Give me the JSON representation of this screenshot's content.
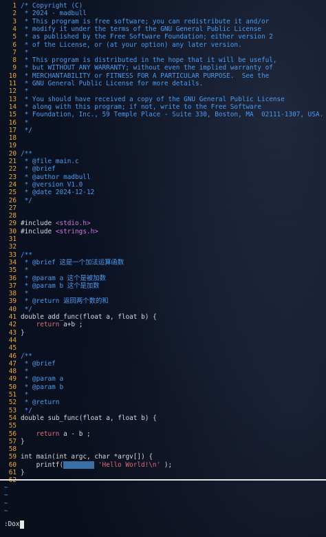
{
  "editor": {
    "lines": [
      {
        "n": "1",
        "t": "/* Copyright (C)",
        "k": "cmt"
      },
      {
        "n": "2",
        "t": " * 2024 - madbull",
        "k": "cmt"
      },
      {
        "n": "3",
        "t": " * This program is free software; you can redistribute it and/or",
        "k": "cmt"
      },
      {
        "n": "4",
        "t": " * modify it under the terms of the GNU General Public License",
        "k": "cmt"
      },
      {
        "n": "5",
        "t": " * as published by the Free Software Foundation; either version 2",
        "k": "cmt"
      },
      {
        "n": "6",
        "t": " * of the License, or (at your option) any later version.",
        "k": "cmt"
      },
      {
        "n": "7",
        "t": " *",
        "k": "cmt"
      },
      {
        "n": "8",
        "t": " * This program is distributed in the hope that it will be useful,",
        "k": "cmt"
      },
      {
        "n": "9",
        "t": " * but WITHOUT ANY WARRANTY; without even the implied warranty of",
        "k": "cmt"
      },
      {
        "n": "10",
        "t": " * MERCHANTABILITY or FITNESS FOR A PARTICULAR PURPOSE.  See the",
        "k": "cmt"
      },
      {
        "n": "11",
        "t": " * GNU General Public License for more details.",
        "k": "cmt"
      },
      {
        "n": "12",
        "t": " *",
        "k": "cmt"
      },
      {
        "n": "13",
        "t": " * You should have received a copy of the GNU General Public License",
        "k": "cmt"
      },
      {
        "n": "14",
        "t": " * along with this program; if not, write to the Free Software",
        "k": "cmt"
      },
      {
        "n": "15",
        "t": " * Foundation, Inc., 59 Temple Place - Suite 330, Boston, MA  02111-1307, USA.",
        "k": "cmt"
      },
      {
        "n": "16",
        "t": " *",
        "k": "cmt"
      },
      {
        "n": "17",
        "t": " */",
        "k": "cmt"
      },
      {
        "n": "18",
        "t": "",
        "k": "plain"
      },
      {
        "n": "19",
        "t": "",
        "k": "plain"
      },
      {
        "n": "20",
        "t": "/**",
        "k": "cmt"
      },
      {
        "n": "21",
        "t": " * @file main.c",
        "k": "cmt"
      },
      {
        "n": "22",
        "t": " * @brief",
        "k": "cmt"
      },
      {
        "n": "23",
        "t": " * @author madbull",
        "k": "cmt"
      },
      {
        "n": "24",
        "t": " * @version V1.0",
        "k": "cmt"
      },
      {
        "n": "25",
        "t": " * @date 2024-12-12",
        "k": "cmt"
      },
      {
        "n": "26",
        "t": " */",
        "k": "cmt"
      },
      {
        "n": "27",
        "t": "",
        "k": "plain"
      },
      {
        "n": "28",
        "t": "",
        "k": "plain"
      },
      {
        "n": "29",
        "t": "#include ",
        "k": "pp",
        "extra": "<stdio.h>"
      },
      {
        "n": "30",
        "t": "#include ",
        "k": "pp",
        "extra": "<strings.h>"
      },
      {
        "n": "31",
        "t": "",
        "k": "plain"
      },
      {
        "n": "32",
        "t": "",
        "k": "plain"
      },
      {
        "n": "33",
        "t": "/**",
        "k": "cmt"
      },
      {
        "n": "34",
        "t": " * @brief 这是一个加法运算函数",
        "k": "cmt"
      },
      {
        "n": "35",
        "t": " *",
        "k": "cmt"
      },
      {
        "n": "36",
        "t": " * @param a 这个是被加数",
        "k": "cmt"
      },
      {
        "n": "37",
        "t": " * @param b 这个是加数",
        "k": "cmt"
      },
      {
        "n": "38",
        "t": " *",
        "k": "cmt"
      },
      {
        "n": "39",
        "t": " * @return 返回两个数的和",
        "k": "cmt"
      },
      {
        "n": "40",
        "t": " */",
        "k": "cmt"
      },
      {
        "n": "41",
        "t": "double add_func(float a, float b) {",
        "k": "plain"
      },
      {
        "n": "42",
        "t": "    return a+b ;",
        "k": "ret"
      },
      {
        "n": "43",
        "t": "}",
        "k": "plain"
      },
      {
        "n": "44",
        "t": "",
        "k": "plain"
      },
      {
        "n": "45",
        "t": "",
        "k": "plain"
      },
      {
        "n": "46",
        "t": "/**",
        "k": "cmt"
      },
      {
        "n": "47",
        "t": " * @brief",
        "k": "cmt"
      },
      {
        "n": "48",
        "t": " *",
        "k": "cmt"
      },
      {
        "n": "49",
        "t": " * @param a",
        "k": "cmt"
      },
      {
        "n": "50",
        "t": " * @param b",
        "k": "cmt"
      },
      {
        "n": "51",
        "t": " *",
        "k": "cmt"
      },
      {
        "n": "52",
        "t": " * @return",
        "k": "cmt"
      },
      {
        "n": "53",
        "t": " */",
        "k": "cmt"
      },
      {
        "n": "54",
        "t": "double sub_func(float a, float b) {",
        "k": "plain"
      },
      {
        "n": "55",
        "t": "",
        "k": "plain"
      },
      {
        "n": "56",
        "t": "    return a - b ;",
        "k": "ret"
      },
      {
        "n": "57",
        "t": "}",
        "k": "plain"
      },
      {
        "n": "58",
        "t": "",
        "k": "plain"
      },
      {
        "n": "59",
        "t": "int main(int argc, char *argv[]) {",
        "k": "plain"
      },
      {
        "n": "60",
        "t": "    printf(",
        "k": "printf",
        "sel": "        ",
        "str": " \"Hello World!\\n\" );"
      },
      {
        "n": "61",
        "t": "}",
        "k": "plain"
      },
      {
        "n": "62",
        "t": "",
        "k": "plain"
      }
    ],
    "tildes": [
      "~",
      "~",
      "~",
      "~"
    ]
  },
  "cmdline": {
    "text": ":Dox"
  }
}
